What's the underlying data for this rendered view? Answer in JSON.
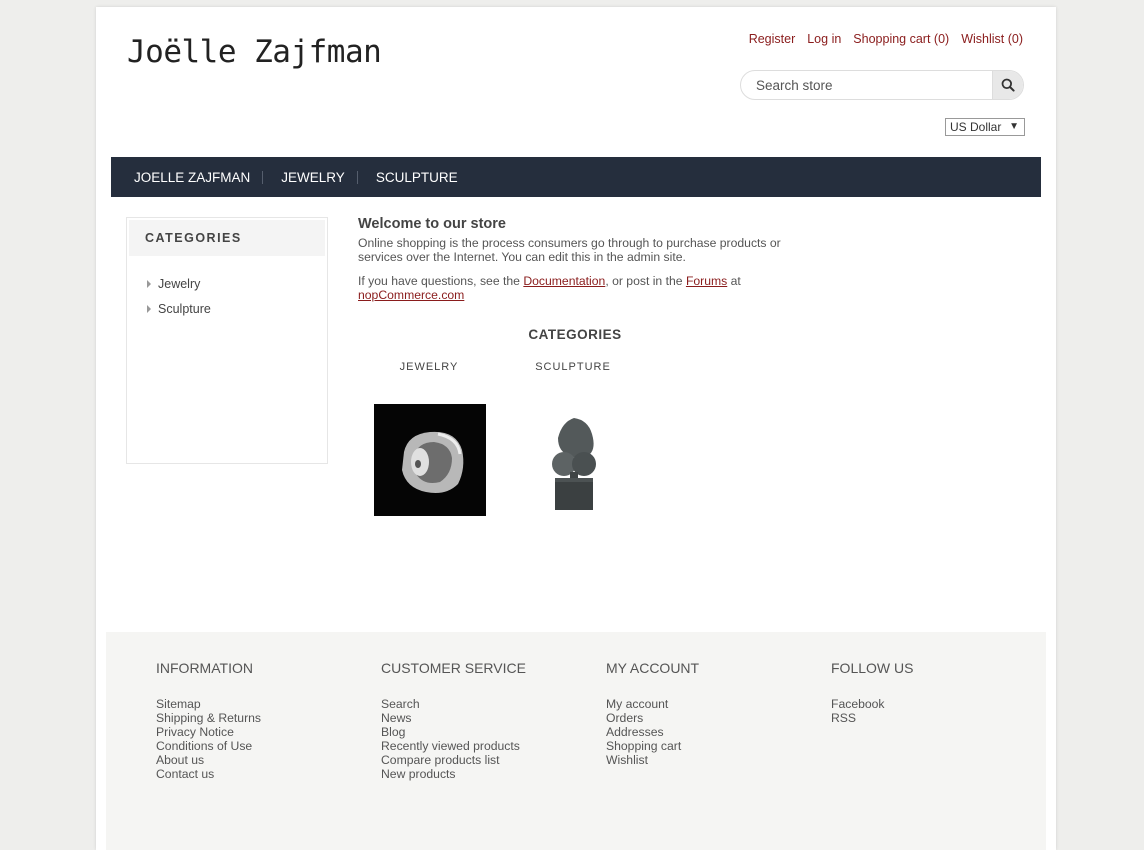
{
  "header": {
    "logo": "Joëlle Zajfman",
    "links": {
      "register": "Register",
      "login": "Log in",
      "cart": "Shopping cart (0)",
      "wishlist": "Wishlist (0)"
    },
    "search_placeholder": "Search store",
    "currency": "US Dollar"
  },
  "nav": {
    "items": [
      "JOELLE ZAJFMAN",
      "JEWELRY",
      "SCULPTURE"
    ]
  },
  "sidebar": {
    "title": "CATEGORIES",
    "items": [
      "Jewelry",
      "Sculpture"
    ]
  },
  "main": {
    "welcome_title": "Welcome to our store",
    "welcome_text": "Online shopping is the process consumers go through to purchase products or services over the Internet. You can edit this in the admin site.",
    "q_prefix": "If you have questions, see the ",
    "doc_link": "Documentation",
    "q_mid": ", or post in the ",
    "forums_link": "Forums",
    "q_at": " at",
    "nop_link": "nopCommerce.com",
    "categories_heading": "CATEGORIES",
    "categories": [
      "JEWELRY",
      "SCULPTURE"
    ]
  },
  "footer": {
    "information": {
      "title": "INFORMATION",
      "links": [
        "Sitemap",
        "Shipping & Returns",
        "Privacy Notice",
        "Conditions of Use",
        "About us",
        "Contact us"
      ]
    },
    "customer_service": {
      "title": "CUSTOMER SERVICE",
      "links": [
        "Search",
        "News",
        "Blog",
        "Recently viewed products",
        "Compare products list",
        "New products"
      ]
    },
    "my_account": {
      "title": "MY ACCOUNT",
      "links": [
        "My account",
        "Orders",
        "Addresses",
        "Shopping cart",
        "Wishlist"
      ]
    },
    "follow_us": {
      "title": "FOLLOW US",
      "links": [
        "Facebook",
        "RSS"
      ]
    }
  },
  "colors": {
    "link": "#8a1c1c",
    "nav_bg": "#252e3d",
    "footer_bg": "#f5f5f3"
  },
  "icons": {
    "search": "search-icon",
    "currency_arrow": "dropdown-arrow-icon",
    "sidebar_bullet": "triangle-right-icon"
  }
}
